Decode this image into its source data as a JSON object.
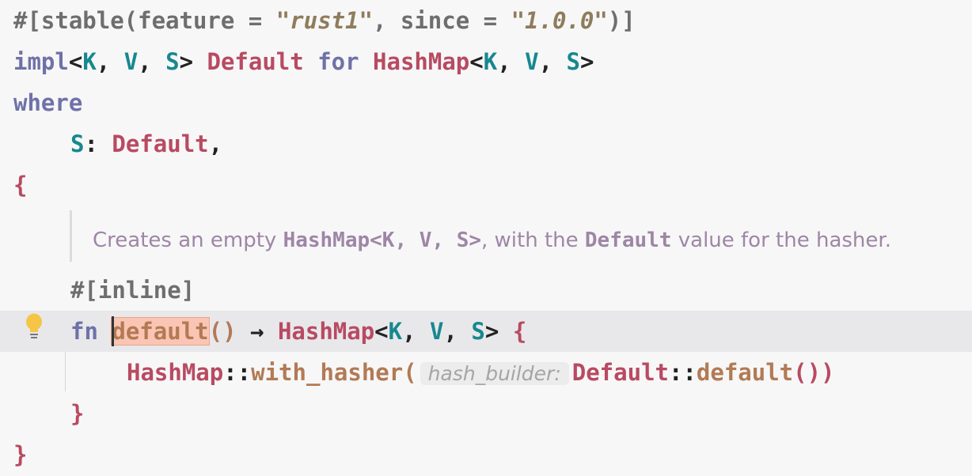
{
  "code": {
    "line1": {
      "attr_open": "#[stable(feature = ",
      "feature_value": "\"rust1\"",
      "attr_mid": ", since = ",
      "since_value": "\"1.0.0\"",
      "attr_close": ")]"
    },
    "line2": {
      "impl_kw": "impl",
      "lt1": "<",
      "k1": "K",
      "comma1": ", ",
      "v1": "V",
      "comma2": ", ",
      "s1": "S",
      "gt1": ">",
      "trait_name": "Default",
      "for_kw": "for",
      "hashmap_type": "HashMap",
      "lt2": "<",
      "k2": "K",
      "comma3": ", ",
      "v2": "V",
      "comma4": ", ",
      "s2": "S",
      "gt2": ">"
    },
    "line3": {
      "where_kw": "where"
    },
    "line4": {
      "s_param": "S",
      "colon": ": ",
      "bound": "Default",
      "comma": ","
    },
    "line5": {
      "open_brace": "{"
    },
    "doc": {
      "prefix": "Creates an empty ",
      "code1": "HashMap<K, V, S>",
      "mid": ", with the ",
      "code2": "Default",
      "suffix": " value for the hasher."
    },
    "line6": {
      "inline_attr": "#[inline]"
    },
    "line7": {
      "fn_kw": "fn",
      "fn_name": "default",
      "parens": "()",
      "arrow": "→",
      "ret_type": "HashMap",
      "lt": "<",
      "k": "K",
      "comma1": ", ",
      "v": "V",
      "comma2": ", ",
      "s": "S",
      "gt": ">",
      "open_brace": "{"
    },
    "line8": {
      "type_name": "HashMap",
      "path_sep1": "::",
      "method": "with_hasher",
      "open_paren": "(",
      "param_hint": "hash_builder:",
      "arg_type": "Default",
      "path_sep2": "::",
      "arg_fn": "default",
      "close_parens": "())"
    },
    "line9": {
      "close_brace": "}"
    },
    "line10": {
      "close_brace": "}"
    }
  },
  "colors": {
    "keyword": "#6f72a8",
    "type": "#b84a62",
    "type_param": "#17888f",
    "function": "#b27a55",
    "attribute": "#6e6e6e",
    "string": "#8e7c5c",
    "doc_comment": "#9e86a6",
    "current_line": "#e8e8eb",
    "highlight": "#fbc5b3"
  },
  "gutter": {
    "intention_icon": "lightbulb-icon"
  }
}
